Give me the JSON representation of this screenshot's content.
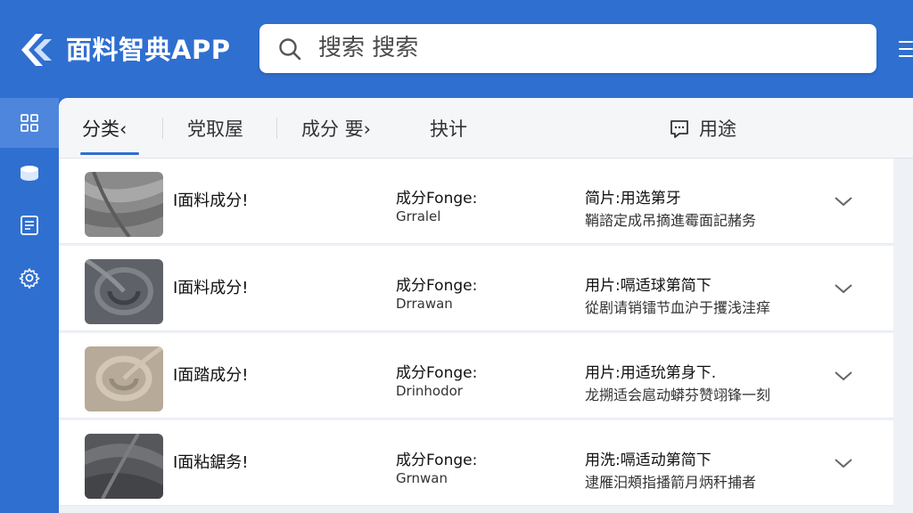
{
  "header": {
    "app_title": "面料智典APP",
    "search_placeholder": "搜索 搜索"
  },
  "sidebar": {
    "items": [
      {
        "icon": "grid-icon",
        "active": true
      },
      {
        "icon": "database-icon",
        "active": false
      },
      {
        "icon": "document-icon",
        "active": false
      },
      {
        "icon": "gear-icon",
        "active": false
      }
    ]
  },
  "tabs": [
    {
      "label": "分类‹",
      "active": true
    },
    {
      "label": "党取屋",
      "active": false
    },
    {
      "label": "成分 要›",
      "active": false
    },
    {
      "label": "抉计",
      "active": false
    },
    {
      "label": "用途",
      "active": false,
      "icon": "chat-icon"
    }
  ],
  "rows": [
    {
      "name": "I面料成分!",
      "composition_title": "成分Fonge:",
      "composition_sub": "Grralel",
      "usage_title": "简片:用选第牙",
      "usage_sub": "鞘諮定成吊摘進霉面記赭务",
      "thumb_color": "#8a8a8a"
    },
    {
      "name": "I面料成分!",
      "composition_title": "成分Fonge:",
      "composition_sub": "Drrawan",
      "usage_title": "用片:嗝适球第简下",
      "usage_sub": "從剧请销镭节血沪于攫浅洼痒",
      "thumb_color": "#5e6268"
    },
    {
      "name": "I面踏成分!",
      "composition_title": "成分Fonge:",
      "composition_sub": "Drinhodor",
      "usage_title": "用片:用适玧第身下.",
      "usage_sub": "龙搠适会扈动蟒芬赞翊锋一刻",
      "thumb_color": "#b7aa98"
    },
    {
      "name": "I面粘鋸务!",
      "composition_title": "成分Fonge:",
      "composition_sub": "Grnwan",
      "usage_title": "用洗:嗝适动第简下",
      "usage_sub": "逮雁汨頰指播箭月炳秆捕者",
      "thumb_color": "#55575a"
    }
  ]
}
